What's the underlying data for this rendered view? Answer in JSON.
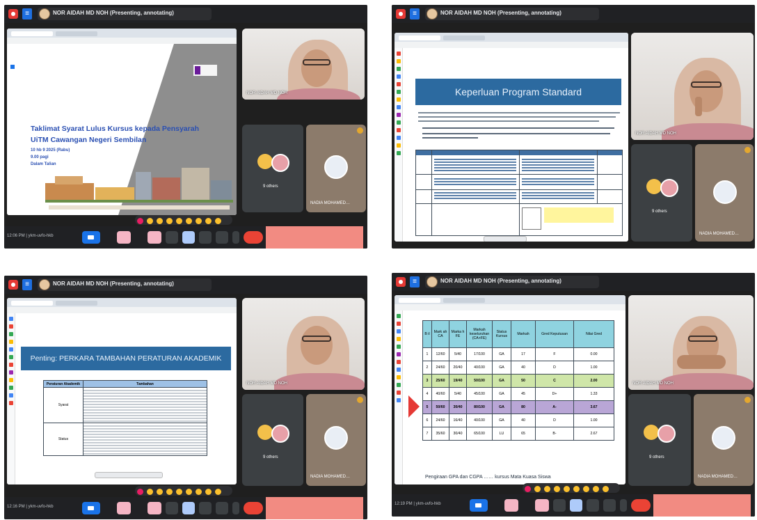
{
  "panels": [
    {
      "presenter_title": "NOR AIDAH MD NOH (Presenting, annotating)",
      "slide": {
        "title_line1": "Taklimat Syarat Lulus Kursus kepada Pensyarah",
        "title_line2": "UiTM Cawangan Negeri Sembilan",
        "date_line": "10 hb 9 2025 (Rabu)",
        "time_line": "9.00 pagi",
        "venue_line": "Dalam Talian"
      },
      "presenter_tag": "NOR AIDAH MD NOH",
      "others_label": "9 others",
      "nadia_label": "NADIA MOHAMED…",
      "time": "12:06 PM",
      "meet_code": "ykm-uvfo-hkb"
    },
    {
      "presenter_title": "NOR AIDAH MD NOH (Presenting, annotating)",
      "slide": {
        "banner": "Keperluan Program Standard"
      },
      "presenter_tag": "NOR AIDAH MD NOH",
      "others_label": "9 others",
      "nadia_label": "NADIA MOHAMED…"
    },
    {
      "presenter_title": "NOR AIDAH MD NOH (Presenting, annotating)",
      "slide": {
        "banner": "Penting: PERKARA TAMBAHAN PERATURAN AKADEMIK",
        "col1": "Peraturan Akademik",
        "col2": "Tambahan",
        "row1": "Syarat",
        "row2": "Status"
      },
      "presenter_tag": "NOR AIDAH MD NOH",
      "others_label": "9 others",
      "nadia_label": "NADIA MOHAMED…",
      "time": "12:16 PM",
      "meet_code": "ykm-uvfo-hkb"
    },
    {
      "presenter_title": "NOR AIDAH MD NOH (Presenting, annotating)",
      "table": {
        "headers": [
          "B\nil",
          "Mark ah CA",
          "Marka h FE",
          "Markah keseluruhan (CA+FE)",
          "Status Kursus",
          "Markah",
          "Gred Keputusan",
          "Nilai Gred"
        ],
        "rows": [
          [
            "1",
            "12/60",
            "5/40",
            "17/100",
            "GA",
            "17",
            "F",
            "0.00"
          ],
          [
            "2",
            "24/60",
            "20/40",
            "40/100",
            "GA",
            "40",
            "D",
            "1.00"
          ],
          [
            "3",
            "25/60",
            "19/40",
            "50/100",
            "GA",
            "50",
            "C",
            "2.00"
          ],
          [
            "4",
            "40/60",
            "5/40",
            "45/100",
            "GA",
            "45",
            "D+",
            "1.33"
          ],
          [
            "5",
            "50/60",
            "30/40",
            "80/100",
            "GA",
            "80",
            "A-",
            "3.67"
          ],
          [
            "6",
            "24/60",
            "16/40",
            "40/100",
            "GA",
            "40",
            "D",
            "1.00"
          ],
          [
            "7",
            "35/60",
            "30/40",
            "65/100",
            "LU",
            "65",
            "B-",
            "2.67"
          ]
        ],
        "footer": "Pengiraan GPA dan CGPA …… kursus Mata Kuasa Siswa"
      },
      "presenter_tag": "NOR AIDAH MD NOH",
      "others_label": "9 others",
      "nadia_label": "NADIA MOHAMED…",
      "time": "12:19 PM",
      "meet_code": "ykm-uvfo-hkb"
    }
  ],
  "colors": {
    "meet_dark": "#202124",
    "leave_red": "#ea4335",
    "slide_blue": "#2c6aa0",
    "row_green": "#cfe6a8",
    "row_purple": "#b9a6d6",
    "arrow_red": "#e53935"
  }
}
